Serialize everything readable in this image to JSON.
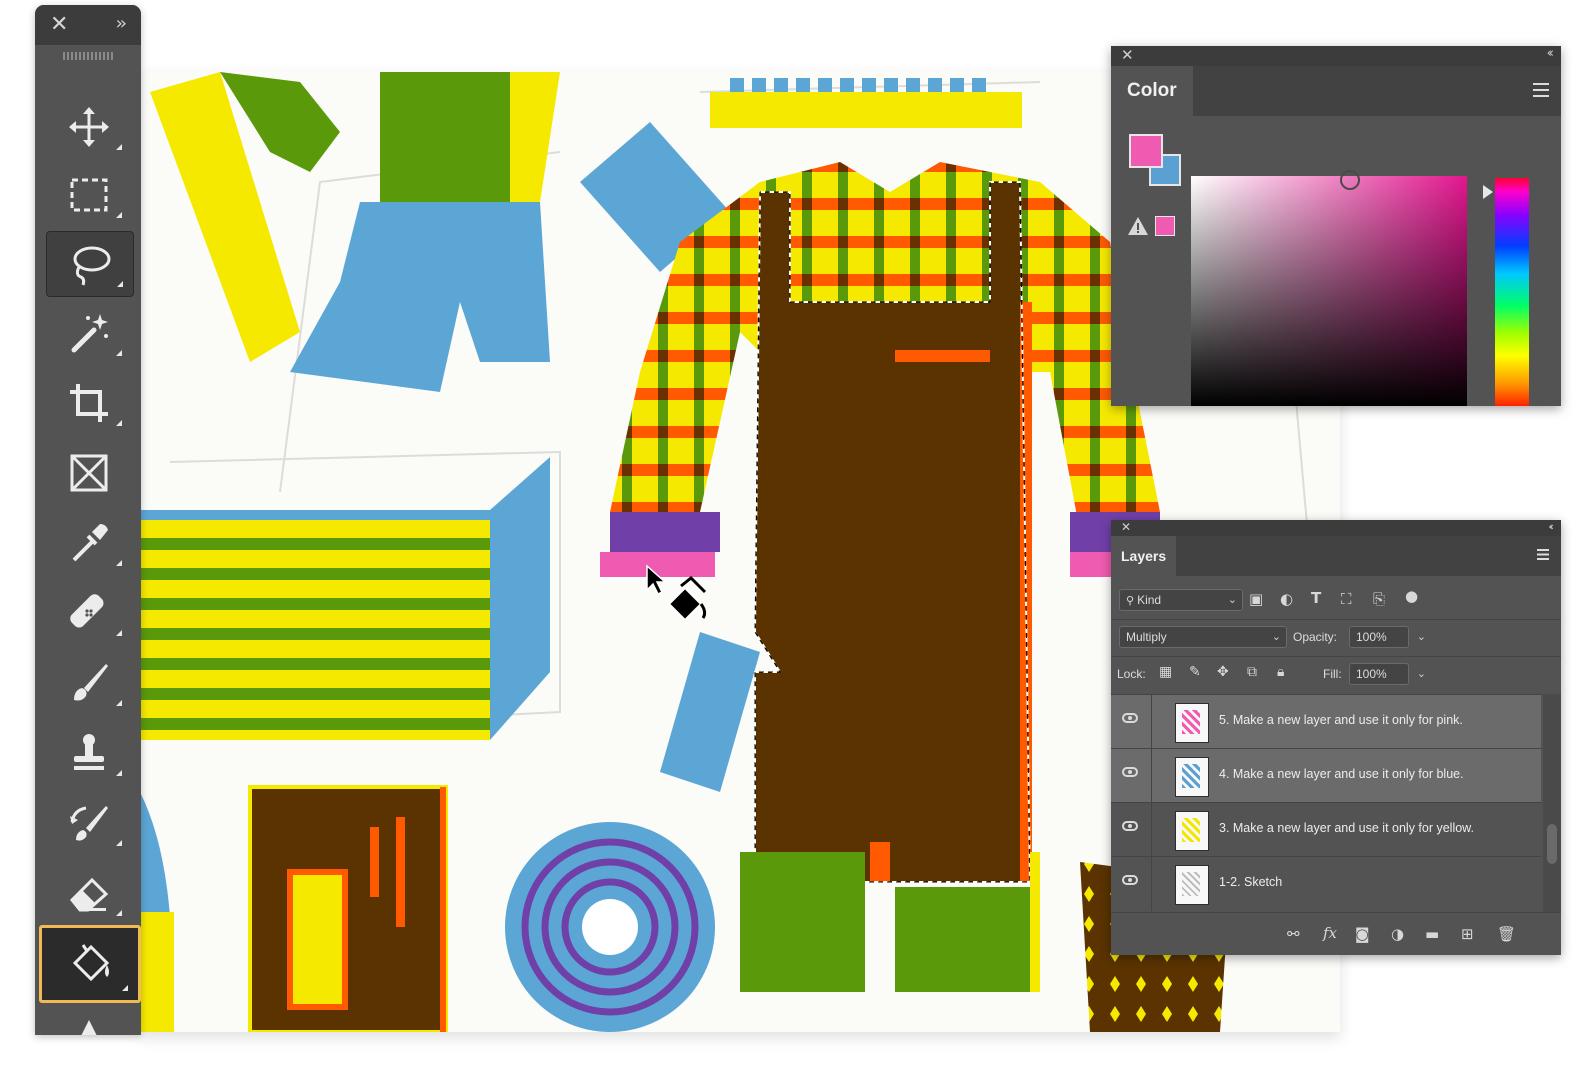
{
  "app": "Photoshop",
  "toolbar": {
    "close_glyph": "✕",
    "collapse_glyph": "››",
    "tools": [
      {
        "id": "move",
        "icon": "move-icon"
      },
      {
        "id": "marquee",
        "icon": "rectangular-marquee-icon"
      },
      {
        "id": "lasso",
        "icon": "lasso-icon",
        "state": "selected"
      },
      {
        "id": "magic-wand",
        "icon": "magic-wand-icon"
      },
      {
        "id": "crop",
        "icon": "crop-icon"
      },
      {
        "id": "frame",
        "icon": "frame-icon"
      },
      {
        "id": "eyedropper",
        "icon": "eyedropper-icon"
      },
      {
        "id": "healing",
        "icon": "spot-healing-icon"
      },
      {
        "id": "brush",
        "icon": "brush-icon"
      },
      {
        "id": "stamp",
        "icon": "clone-stamp-icon"
      },
      {
        "id": "history-brush",
        "icon": "history-brush-icon"
      },
      {
        "id": "eraser",
        "icon": "eraser-icon"
      },
      {
        "id": "paint-bucket",
        "icon": "paint-bucket-icon",
        "state": "active"
      }
    ]
  },
  "color_panel": {
    "tab": "Color",
    "foreground_color": "#ef5bb0",
    "background_color": "#5aa0d2",
    "warning_icon": "gamut-warning-icon"
  },
  "layers_panel": {
    "tab": "Layers",
    "filter_kind": "Kind",
    "blend_mode": "Multiply",
    "opacity_label": "Opacity:",
    "opacity_value": "100%",
    "lock_label": "Lock:",
    "fill_label": "Fill:",
    "fill_value": "100%",
    "layers": [
      {
        "name": "5. Make a new layer and use it only for pink.",
        "selected": true,
        "thumb_color": "#ef5bb0"
      },
      {
        "name": "4. Make a new layer and use it only for blue.",
        "selected": true,
        "thumb_color": "#5aa0d2"
      },
      {
        "name": "3. Make a new layer and use it only for yellow.",
        "selected": false,
        "thumb_color": "#f3e600"
      },
      {
        "name": "1-2. Sketch",
        "selected": false,
        "thumb_color": "#bdbdbd"
      }
    ]
  },
  "colors": {
    "yellow": "#f5e900",
    "green": "#5a9a0a",
    "blue": "#5ca6d6",
    "orange": "#ff5a00",
    "brown": "#5a3300",
    "purple": "#7040a8",
    "pink": "#ef5bb0"
  }
}
